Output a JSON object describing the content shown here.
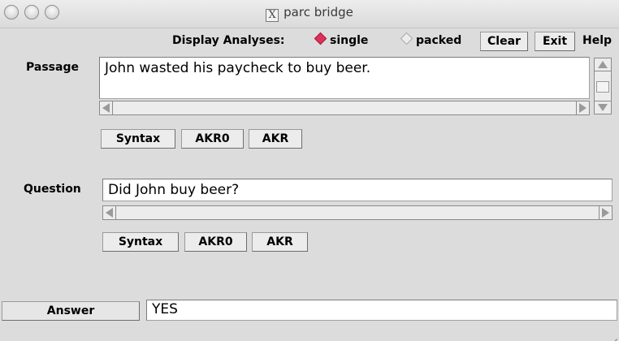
{
  "window": {
    "title": "parc bridge",
    "title_icon": "x11-icon"
  },
  "toolbar": {
    "display_label": "Display Analyses:",
    "single_label": "single",
    "packed_label": "packed",
    "selected_mode": "single",
    "clear_label": "Clear",
    "exit_label": "Exit",
    "help_label": "Help"
  },
  "passage": {
    "label": "Passage",
    "text": "John wasted his paycheck to buy beer.",
    "buttons": {
      "syntax": "Syntax",
      "akr0": "AKR0",
      "akr": "AKR"
    }
  },
  "question": {
    "label": "Question",
    "text": "Did John buy beer?",
    "buttons": {
      "syntax": "Syntax",
      "akr0": "AKR0",
      "akr": "AKR"
    }
  },
  "answer": {
    "button_label": "Answer",
    "value": "YES"
  },
  "colors": {
    "radio_selected": "#e0305a",
    "background": "#dcdcdc"
  }
}
